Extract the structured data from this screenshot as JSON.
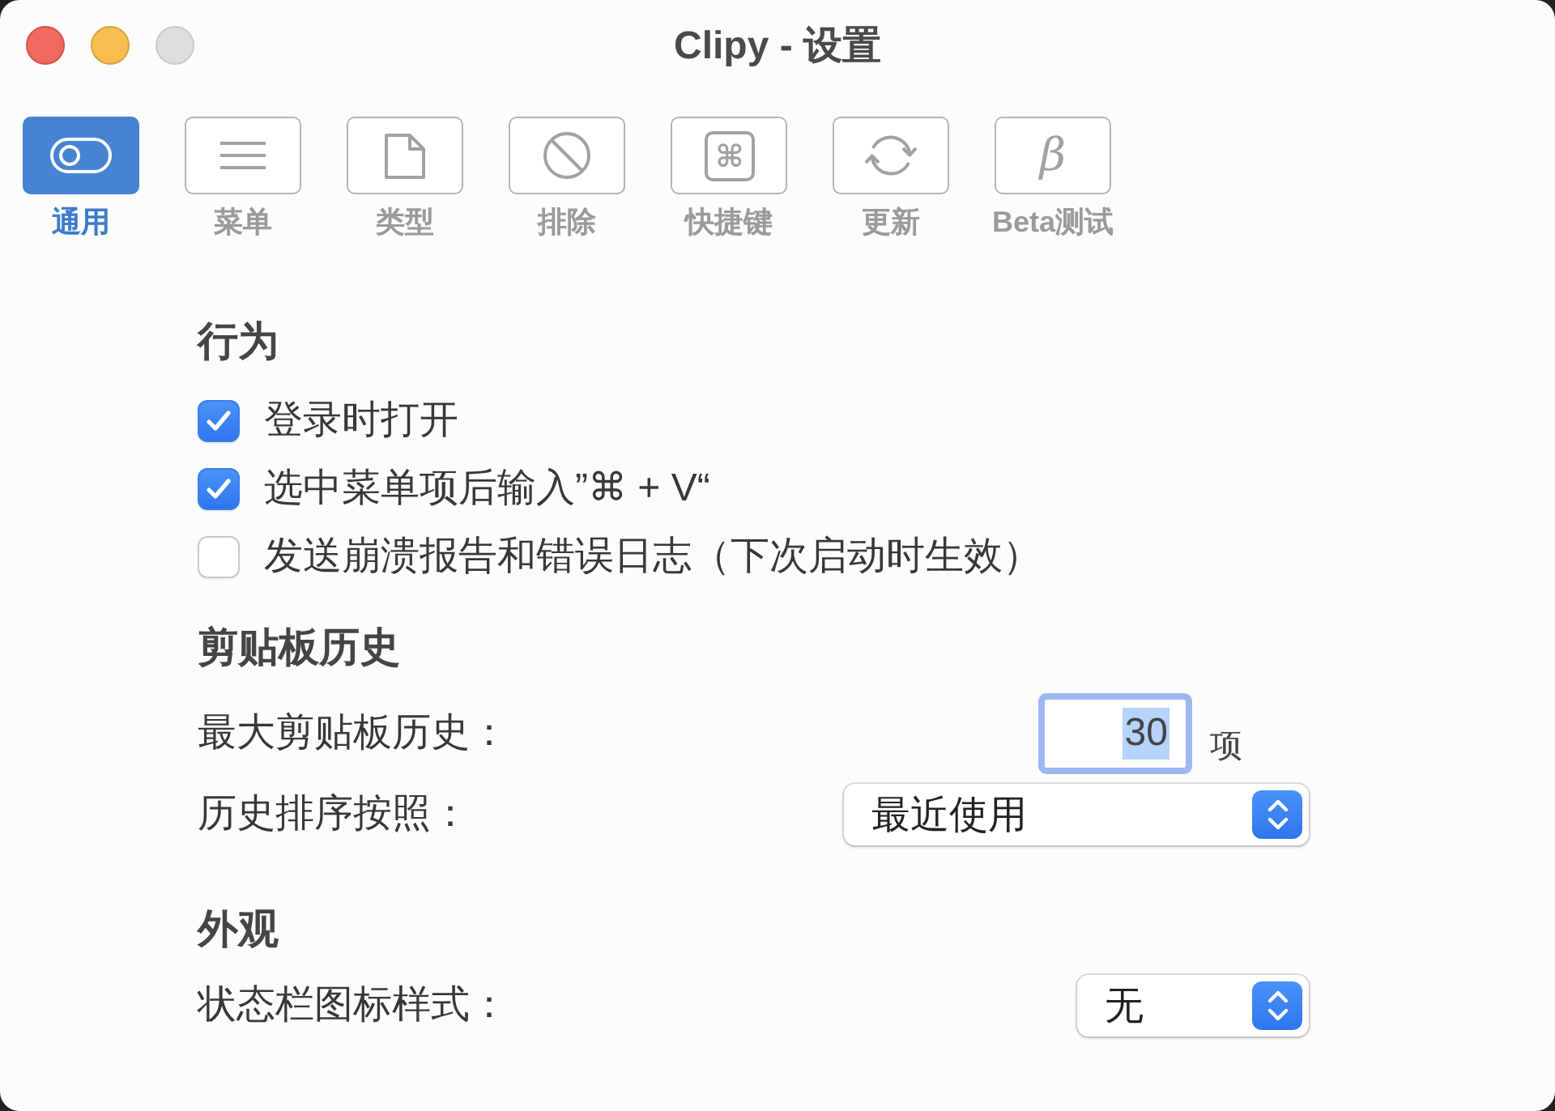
{
  "window": {
    "title": "Clipy - 设置",
    "controls": [
      {
        "kind": "close",
        "disabled": false
      },
      {
        "kind": "minimize",
        "disabled": false
      },
      {
        "kind": "zoom",
        "disabled": true
      }
    ]
  },
  "tabs": [
    {
      "kind": "toggle",
      "label": "通用",
      "selected": true
    },
    {
      "kind": "list",
      "label": "菜单",
      "selected": false
    },
    {
      "kind": "document",
      "label": "类型",
      "selected": false
    },
    {
      "kind": "prohibit",
      "label": "排除",
      "selected": false
    },
    {
      "kind": "command",
      "glyph": "⌘",
      "label": "快捷键",
      "selected": false
    },
    {
      "kind": "sync",
      "label": "更新",
      "selected": false
    },
    {
      "kind": "letter",
      "glyph": "β",
      "label": "Beta测试",
      "selected": false
    }
  ],
  "sections": [
    {
      "heading": "行为",
      "items": [
        {
          "kind": "checkbox",
          "label": "登录时打开",
          "checked": true
        },
        {
          "kind": "checkbox",
          "label": "选中菜单项后输入”⌘ + V“",
          "checked": true
        },
        {
          "kind": "checkbox",
          "label": "发送崩溃报告和错误日志（下次启动时生效）",
          "checked": false
        }
      ]
    },
    {
      "heading": "剪贴板历史",
      "items": [
        {
          "kind": "number",
          "label": "最大剪贴板历史：",
          "value": "30",
          "unit": "项",
          "focused": true
        },
        {
          "kind": "popup",
          "label": "历史排序按照：",
          "value": "最近使用"
        }
      ]
    },
    {
      "heading": "外观",
      "items": [
        {
          "kind": "popup",
          "label": "状态栏图标样式：",
          "value": "无"
        }
      ]
    }
  ]
}
